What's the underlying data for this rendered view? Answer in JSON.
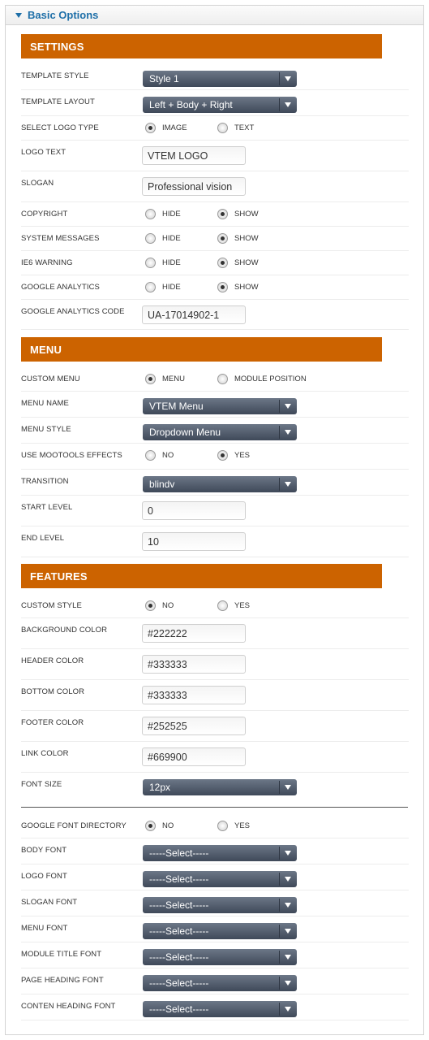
{
  "panel": {
    "title": "Basic Options"
  },
  "sections": {
    "settings": "SETTINGS",
    "menu": "MENU",
    "features": "FEATURES"
  },
  "settings": {
    "template_style": {
      "label": "TEMPLATE STYLE",
      "value": "Style 1"
    },
    "template_layout": {
      "label": "TEMPLATE LAYOUT",
      "value": "Left + Body + Right"
    },
    "logo_type": {
      "label": "SELECT LOGO TYPE",
      "opt1": "IMAGE",
      "opt2": "TEXT",
      "selected": "IMAGE"
    },
    "logo_text": {
      "label": "LOGO TEXT",
      "value": "VTEM LOGO"
    },
    "slogan": {
      "label": "SLOGAN",
      "value": "Professional vision"
    },
    "copyright": {
      "label": "COPYRIGHT",
      "opt1": "HIDE",
      "opt2": "SHOW",
      "selected": "SHOW"
    },
    "system_messages": {
      "label": "SYSTEM MESSAGES",
      "opt1": "HIDE",
      "opt2": "SHOW",
      "selected": "SHOW"
    },
    "ie6_warning": {
      "label": "IE6 WARNING",
      "opt1": "HIDE",
      "opt2": "SHOW",
      "selected": "SHOW"
    },
    "google_analytics": {
      "label": "GOOGLE ANALYTICS",
      "opt1": "HIDE",
      "opt2": "SHOW",
      "selected": "SHOW"
    },
    "google_analytics_code": {
      "label": "GOOGLE ANALYTICS CODE",
      "value": "UA-17014902-1"
    }
  },
  "menu": {
    "custom_menu": {
      "label": "CUSTOM MENU",
      "opt1": "MENU",
      "opt2": "MODULE POSITION",
      "selected": "MENU"
    },
    "menu_name": {
      "label": "MENU NAME",
      "value": "VTEM Menu"
    },
    "menu_style": {
      "label": "MENU STYLE",
      "value": "Dropdown Menu"
    },
    "mootools": {
      "label": "USE MOOTOOLS EFFECTS",
      "opt1": "NO",
      "opt2": "YES",
      "selected": "YES"
    },
    "transition": {
      "label": "TRANSITION",
      "value": "blindv"
    },
    "start_level": {
      "label": "START LEVEL",
      "value": "0"
    },
    "end_level": {
      "label": "END LEVEL",
      "value": "10"
    }
  },
  "features": {
    "custom_style": {
      "label": "CUSTOM STYLE",
      "opt1": "NO",
      "opt2": "YES",
      "selected": "NO"
    },
    "background_color": {
      "label": "BACKGROUND COLOR",
      "value": "#222222"
    },
    "header_color": {
      "label": "HEADER COLOR",
      "value": "#333333"
    },
    "bottom_color": {
      "label": "BOTTOM COLOR",
      "value": "#333333"
    },
    "footer_color": {
      "label": "FOOTER COLOR",
      "value": "#252525"
    },
    "link_color": {
      "label": "LINK COLOR",
      "value": "#669900"
    },
    "font_size": {
      "label": "FONT SIZE",
      "value": "12px"
    },
    "google_font_directory": {
      "label": "GOOGLE FONT DIRECTORY",
      "opt1": "NO",
      "opt2": "YES",
      "selected": "NO"
    },
    "body_font": {
      "label": "BODY FONT",
      "value": "-----Select-----"
    },
    "logo_font": {
      "label": "LOGO FONT",
      "value": "-----Select-----"
    },
    "slogan_font": {
      "label": "SLOGAN FONT",
      "value": "-----Select-----"
    },
    "menu_font": {
      "label": "MENU FONT",
      "value": "-----Select-----"
    },
    "module_title_font": {
      "label": "MODULE TITLE FONT",
      "value": "-----Select-----"
    },
    "page_heading_font": {
      "label": "PAGE HEADING FONT",
      "value": "-----Select-----"
    },
    "content_heading_font": {
      "label": "CONTEN HEADING FONT",
      "value": "-----Select-----"
    }
  },
  "colors": {
    "accent": "#cc6300",
    "header_text": "#1e6fa8",
    "select_bg": "#4b5566"
  }
}
